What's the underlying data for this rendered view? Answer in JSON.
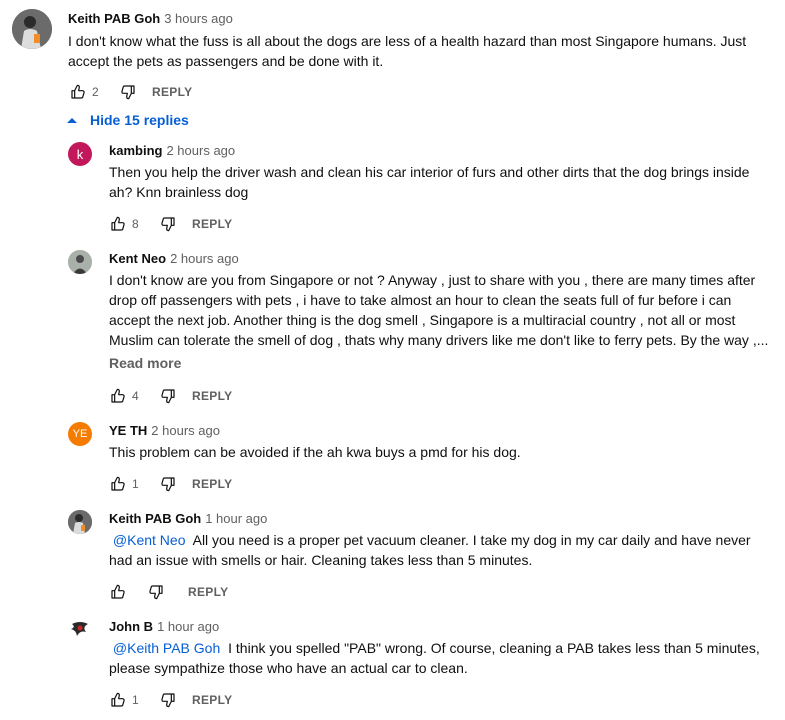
{
  "main_comment": {
    "author": "Keith PAB Goh",
    "time": "3 hours ago",
    "lines": [
      "I don't know what the fuss is all about the dogs are less of a health hazard than most Singapore humans. Just",
      "accept the pets as passengers and be done with it."
    ],
    "likes": "2",
    "reply_label": "REPLY"
  },
  "hide_replies_label": "Hide 15 replies",
  "replies": [
    {
      "author": "kambing",
      "time": "2 hours ago",
      "avatar_letter": "k",
      "avatar_color": "#c2185b",
      "lines": [
        "Then you help the driver wash and clean his car interior of furs and other dirts that the dog brings inside",
        "ah? Knn brainless dog"
      ],
      "likes": "8",
      "reply_label": "REPLY"
    },
    {
      "author": "Kent Neo",
      "time": "2 hours ago",
      "lines": [
        "I don't know are you from Singapore or not ? Anyway , just to share with you , there are many times after",
        "drop off passengers with pets , i have to take almost an hour to clean the seats full of fur before i can",
        "accept the next job. Another thing is the dog smell , Singapore is a multiracial country , not all or most",
        "Muslim can tolerate the smell of dog , thats why many drivers like me don't like to ferry pets. By the way ,..."
      ],
      "read_more": "Read more",
      "likes": "4",
      "reply_label": "REPLY"
    },
    {
      "author": "YE TH",
      "time": "2 hours ago",
      "avatar_letter": "YE",
      "avatar_color": "#f57c00",
      "lines": [
        "This problem can be avoided if the ah kwa buys a pmd for his dog."
      ],
      "likes": "1",
      "reply_label": "REPLY"
    },
    {
      "author": "Keith PAB Goh",
      "time": "1 hour ago",
      "mention": "@Kent Neo",
      "lines": [
        "All you need is a proper pet vacuum cleaner. I take my dog in my car daily and have never",
        "had an issue with smells or hair. Cleaning takes less than 5 minutes."
      ],
      "likes": "",
      "reply_label": "REPLY"
    },
    {
      "author": "John B",
      "time": "1 hour ago",
      "mention": "@Keith PAB Goh",
      "lines": [
        "I think you spelled \"PAB\" wrong. Of course, cleaning a PAB takes less than 5 minutes,",
        "please sympathize those who have an actual car to clean."
      ],
      "likes": "1",
      "reply_label": "REPLY"
    }
  ]
}
